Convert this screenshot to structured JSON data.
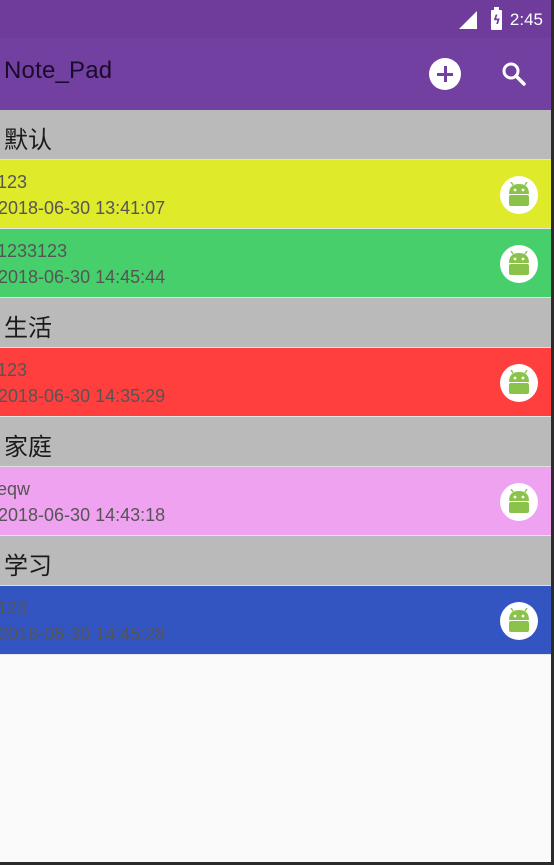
{
  "status_bar": {
    "time": "2:45"
  },
  "app_bar": {
    "title": "Note_Pad"
  },
  "colors": {
    "status_bar": "#6f3c9c",
    "app_bar": "#7240a1",
    "group_header": "#bbbaba",
    "note_yellow": "#dfea2b",
    "note_green": "#47cf6c",
    "note_red": "#ff3f3e",
    "note_pink": "#eea2ef",
    "note_blue": "#3355c1"
  },
  "groups": [
    {
      "name": "默认",
      "notes": [
        {
          "title": "123",
          "date": "2018-06-30 13:41:07",
          "color": "#dfea2b",
          "icon": "android-icon"
        },
        {
          "title": "1233123",
          "date": "2018-06-30 14:45:44",
          "color": "#47cf6c",
          "icon": "android-icon"
        }
      ]
    },
    {
      "name": "生活",
      "notes": [
        {
          "title": "123",
          "date": "2018-06-30 14:35:29",
          "color": "#ff3f3e",
          "icon": "android-icon"
        }
      ]
    },
    {
      "name": "家庭",
      "notes": [
        {
          "title": "eqw",
          "date": "2018-06-30 14:43:18",
          "color": "#eea2ef",
          "icon": "android-icon"
        }
      ]
    },
    {
      "name": "学习",
      "notes": [
        {
          "title": "123",
          "date": "2018-06-30 14:45:28",
          "color": "#3355c1",
          "icon": "android-icon"
        }
      ]
    }
  ]
}
